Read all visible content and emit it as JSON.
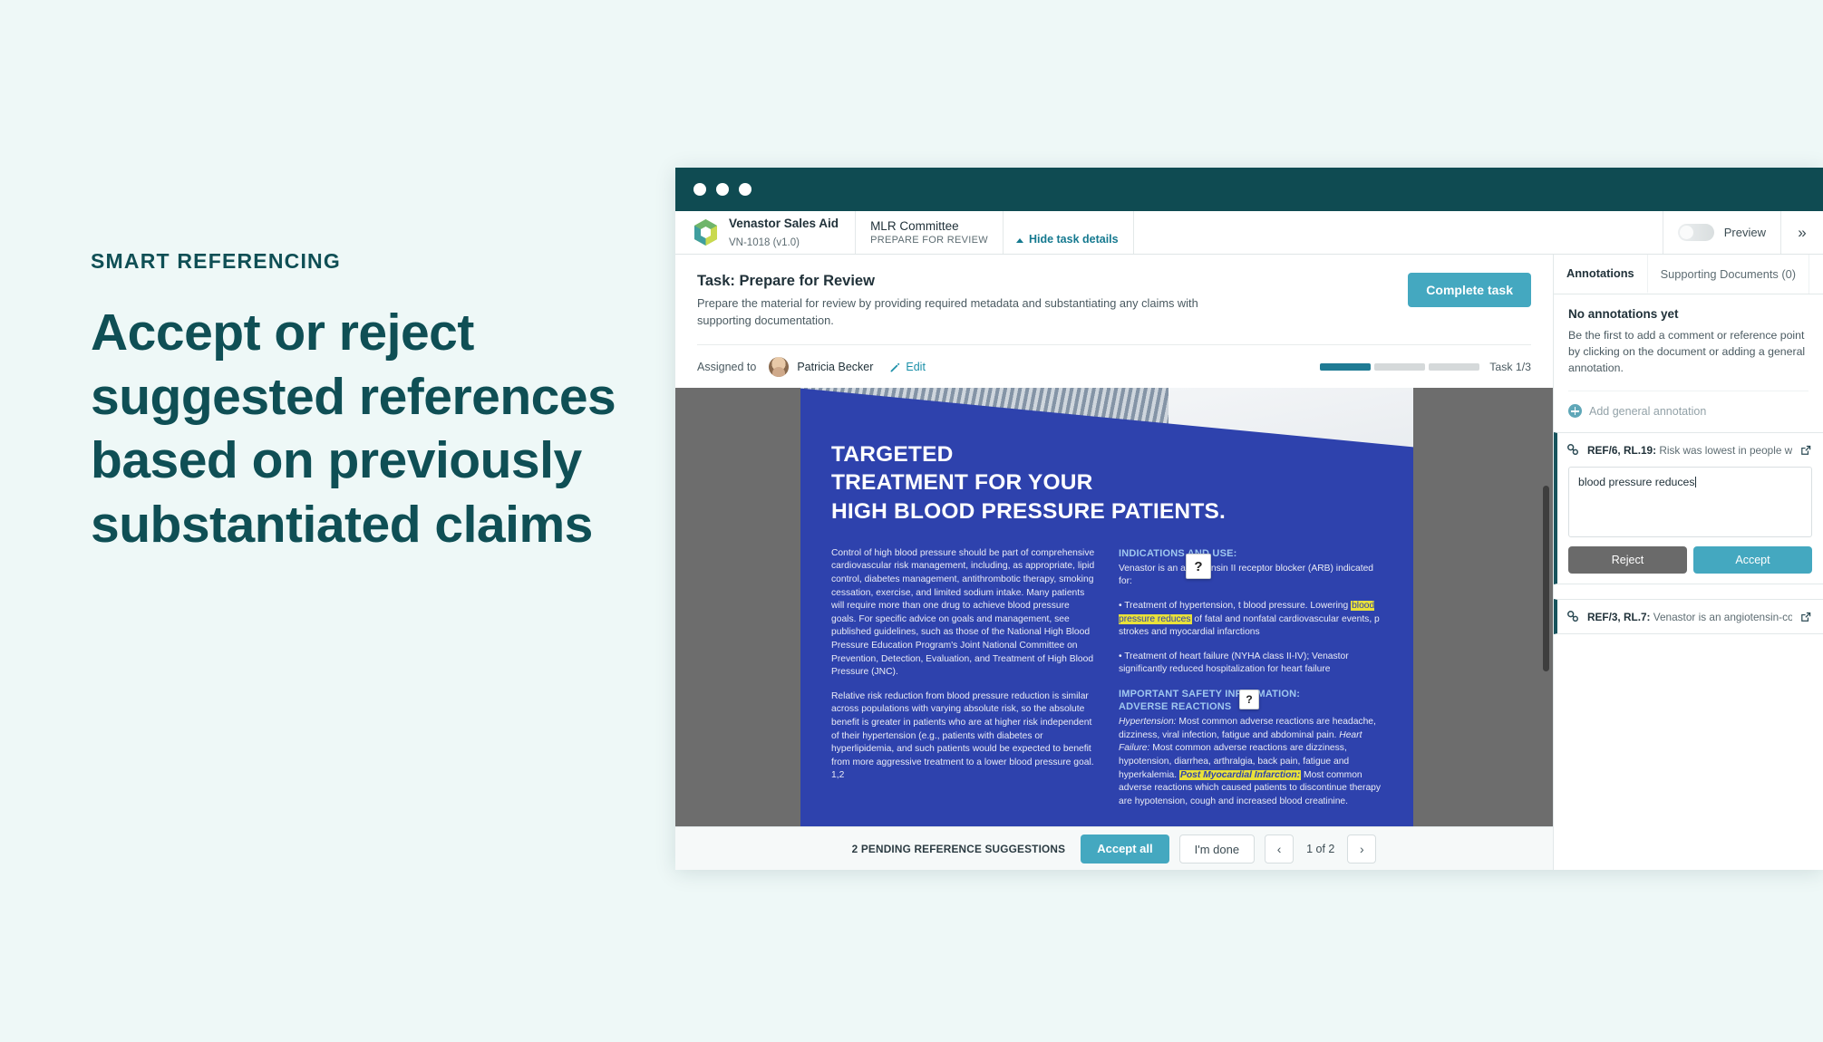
{
  "marketing": {
    "eyebrow": "SMART REFERENCING",
    "headline": "Accept or reject suggested references based on previously substantiated claims"
  },
  "breadcrumb": {
    "doc_title": "Venastor Sales Aid",
    "doc_code": "VN-1018 (v1.0)",
    "stage_title": "MLR Committee",
    "stage_sub": "PREPARE FOR REVIEW",
    "tab_label": "Hide task details",
    "preview_label": "Preview",
    "expand_icon": "»"
  },
  "task": {
    "title": "Task: Prepare for Review",
    "description": "Prepare the material for review by providing required metadata and substantiating any claims with supporting documentation.",
    "complete_label": "Complete task",
    "assigned_label": "Assigned to",
    "assignee": "Patricia Becker",
    "edit_label": "Edit",
    "progress_text": "Task 1/3",
    "progress_segments": [
      true,
      false,
      false
    ]
  },
  "document": {
    "heading_line1": "TARGETED",
    "heading_line2": "TREATMENT FOR YOUR",
    "heading_line3": "HIGH BLOOD PRESSURE PATIENTS.",
    "left_para1": "Control of high blood pressure should be part of comprehensive cardiovascular risk management, including, as appropriate, lipid control, diabetes management, antithrombotic therapy, smoking cessation, exercise, and limited sodium intake. Many patients will require more than one drug to achieve blood pressure goals. For specific advice on goals and management, see published guidelines, such as those of the National High Blood Pressure Education Program's Joint National Committee on Prevention, Detection, Evaluation, and Treatment of High Blood Pressure (JNC).",
    "left_para2": "Relative risk reduction from blood pressure reduction is similar across populations with varying absolute risk, so the absolute benefit is greater in patients who are at higher risk independent of their hypertension (e.g., patients with diabetes or hyperlipidemia, and such patients would be expected to benefit from more aggressive treatment to a lower blood pressure goal. 1,2",
    "indications_heading": "INDICATIONS AND USE:",
    "indications_intro": "Venastor is an angiotensin II receptor blocker (ARB) indicated for:",
    "bullet1_pre": "•  Treatment of hypertension, t",
    "bullet1_mid": "blood pressure. Lowering ",
    "bullet1_hl": "blood pressure reduces",
    "bullet1_post": " of fatal and nonfatal cardiovascular events, p",
    "bullet1_end": "strokes and myocardial infarctions",
    "bullet2": "•  Treatment of heart failure (NYHA class II-IV); Venastor significantly reduced hospitalization for heart failure",
    "safety_heading_line1": "IMPORTANT SAFETY INFORMATION:",
    "safety_heading_line2": "ADVERSE REACTIONS",
    "safety_a": "Hypertension:",
    "safety_b": " Most common adverse reactions are headache, dizziness, viral infection, fatigue and abdominal pain. ",
    "safety_c": "Heart Failure:",
    "safety_d": " Most common adverse reactions are dizziness, hypotension, diarrhea, arthralgia, back pain, fatigue and hyperkalemia. ",
    "safety_hl": "Post Myocardial Infarction:",
    "safety_e": " Most common adverse reactions which caused patients to discontinue therapy are hypotension, cough and increased blood creatinine.",
    "badge_label": "?"
  },
  "bottom_bar": {
    "pending_label": "2 PENDING REFERENCE SUGGESTIONS",
    "accept_all_label": "Accept all",
    "im_done_label": "I'm done",
    "prev_icon": "‹",
    "next_icon": "›",
    "page_count": "1 of 2"
  },
  "annotations_panel": {
    "tabs": [
      {
        "label": "Annotations",
        "active": true
      },
      {
        "label": "Supporting Documents (0)",
        "active": false
      }
    ],
    "empty_title": "No annotations yet",
    "empty_body": "Be the first to add a comment or reference point by clicking on the document or adding a general annotation.",
    "add_label": "Add general annotation",
    "suggestions": [
      {
        "ref": "REF/6, RL.19:",
        "snippet": " Risk was lowest in people with s...",
        "input_value": "blood pressure reduces",
        "reject_label": "Reject",
        "accept_label": "Accept",
        "expanded": true
      },
      {
        "ref": "REF/3, RL.7:",
        "snippet": " Venastor is an angiotensin-conver...",
        "expanded": false
      }
    ]
  },
  "colors": {
    "brand_teal": "#0f4b52",
    "accent_blue": "#44a8c0",
    "page_blue": "#2e42ad",
    "background": "#eef8f7",
    "highlight_yellow": "#e9e13a"
  }
}
